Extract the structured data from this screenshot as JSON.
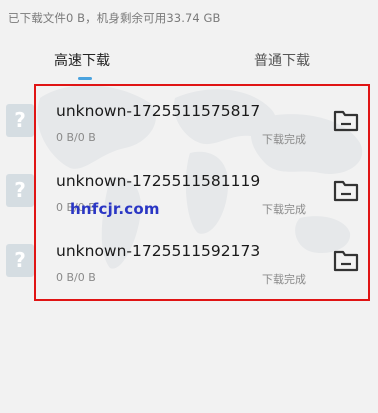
{
  "header": {
    "storage_text": "已下载文件0 B，机身剩余可用33.74 GB"
  },
  "tabs": [
    {
      "label": "高速下载",
      "active": true
    },
    {
      "label": "普通下载",
      "active": false
    }
  ],
  "downloads": [
    {
      "icon": "unknown-file-icon",
      "name": "unknown-1725511575817",
      "size": "0 B/0 B",
      "status": "下载完成"
    },
    {
      "icon": "unknown-file-icon",
      "name": "unknown-1725511581119",
      "size": "0 B/0 B",
      "status": "下载完成"
    },
    {
      "icon": "unknown-file-icon",
      "name": "unknown-1725511592173",
      "size": "0 B/0 B",
      "status": "下载完成"
    }
  ],
  "watermark": "hnfcjr.com",
  "colors": {
    "accent": "#4aa3df",
    "highlight": "#e01414",
    "watermark": "#2a36c4"
  }
}
